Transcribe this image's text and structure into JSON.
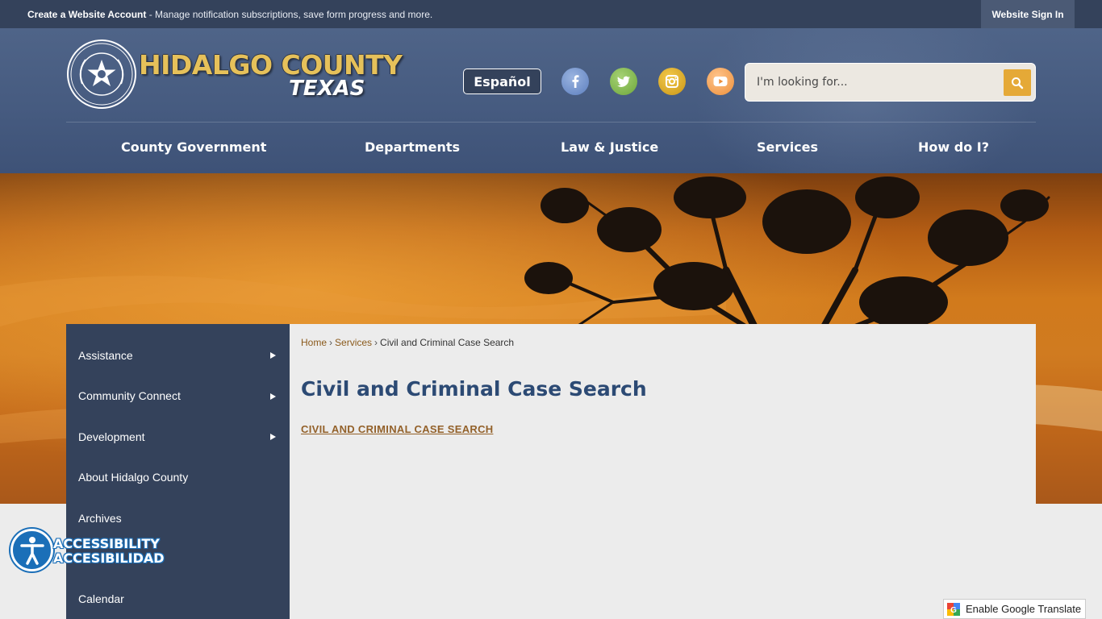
{
  "topbar": {
    "account_link": "Create a Website Account",
    "account_message": " - Manage notification subscriptions, save form progress and more.",
    "sign_in": "Website Sign In"
  },
  "header": {
    "logo_line1": "HIDALGO COUNTY",
    "logo_line2": "TEXAS",
    "language_button": "Español",
    "social": [
      "facebook-icon",
      "twitter-icon",
      "instagram-icon",
      "youtube-icon"
    ],
    "search_placeholder": "I'm looking for..."
  },
  "nav": {
    "items": [
      "County Government",
      "Departments",
      "Law & Justice",
      "Services",
      "How do I?"
    ]
  },
  "sidebar": {
    "items": [
      {
        "label": "Assistance",
        "has_submenu": true
      },
      {
        "label": "Community Connect",
        "has_submenu": true
      },
      {
        "label": "Development",
        "has_submenu": true
      },
      {
        "label": "About Hidalgo County",
        "has_submenu": false
      },
      {
        "label": "Archives",
        "has_submenu": false
      },
      {
        "label": "Calendar",
        "has_submenu": false
      }
    ]
  },
  "breadcrumb": {
    "home": "Home",
    "services": "Services",
    "current": "Civil and Criminal Case Search",
    "separator": "›"
  },
  "main": {
    "title": "Civil and Criminal Case Search",
    "link": "CIVIL AND CRIMINAL CASE SEARCH"
  },
  "accessibility": {
    "line1": "ACCESSIBILITY",
    "line2": "ACCESIBILIDAD"
  },
  "translate": {
    "label": "Enable Google Translate"
  },
  "colors": {
    "topbar": "#34425b",
    "header": "#4b6086",
    "sidebar": "#34425b",
    "accent_gold": "#e5a937",
    "title_blue": "#2c4a74",
    "link_brown": "#93612a"
  }
}
